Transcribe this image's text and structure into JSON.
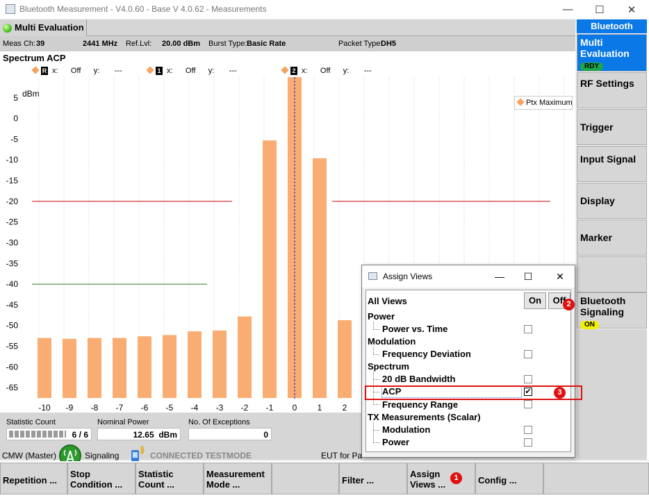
{
  "window": {
    "title": "Bluetooth Measurement  - V4.0.60 - Base V 4.0.62 - Measurements",
    "minimize": "—",
    "maximize": "☐",
    "close": "✕"
  },
  "tab": {
    "label": "Multi Evaluation"
  },
  "info": {
    "meas_ch_label": "Meas Ch:",
    "meas_ch_value": "39",
    "freq_value": "2441 MHz",
    "ref_lvl_label": "Ref.Lvl:",
    "ref_lvl_value": "20.00 dBm",
    "burst_type_label": "Burst Type:",
    "burst_type_value": "Basic Rate",
    "packet_type_label": "Packet Type:",
    "packet_type_value": "DH5"
  },
  "plot": {
    "title": "Spectrum ACP",
    "markers": [
      {
        "badge": "R",
        "x_label": "x:",
        "x_value": "Off",
        "y_label": "y:",
        "y_value": "---"
      },
      {
        "badge": "1",
        "x_label": "x:",
        "x_value": "Off",
        "y_label": "y:",
        "y_value": "---"
      },
      {
        "badge": "2",
        "x_label": "x:",
        "x_value": "Off",
        "y_label": "y:",
        "y_value": "---"
      }
    ],
    "legend": "Ptx Maximum"
  },
  "chart_data": {
    "type": "bar",
    "ylabel": "dBm",
    "categories": [
      "-10",
      "-9",
      "-8",
      "-7",
      "-6",
      "-5",
      "-4",
      "-3",
      "-2",
      "-1",
      "0",
      "1",
      "2"
    ],
    "series": [
      {
        "name": "Ptx Maximum",
        "values": [
          -53,
          -53.2,
          -53,
          -53,
          -52.6,
          -52.3,
          -51.4,
          -51.2,
          -47.8,
          -5.3,
          10,
          -9.6,
          -48.7
        ]
      }
    ],
    "ylim": [
      -68,
      10
    ],
    "yticks": [
      5,
      0,
      -5,
      -10,
      -15,
      -20,
      -25,
      -30,
      -35,
      -40,
      -45,
      -50,
      -55,
      -60,
      -65
    ],
    "limit_lines": [
      {
        "y": -20,
        "from": "-10.5",
        "to": "-2.5",
        "color": "#cc0000"
      },
      {
        "y": -20,
        "from": "1.5",
        "to": "12",
        "color": "#cc0000"
      },
      {
        "y": -40,
        "from": "-10.5",
        "to": "-3.5",
        "color": "#2f7a1a"
      }
    ],
    "grid": "vertical",
    "bar_color": "#f9ad72"
  },
  "stats": {
    "statistic_count_label": "Statistic Count",
    "statistic_count_value": "6 / 6",
    "nominal_power_label": "Nominal Power",
    "nominal_power_value": "12.65  dBm",
    "exceptions_label": "No. Of Exceptions",
    "exceptions_value": "0"
  },
  "status": {
    "cmw": "CMW (Master)",
    "signaling": "Signaling",
    "connected": "CONNECTED TESTMODE",
    "eut": "EUT for Pa"
  },
  "right_keys": {
    "header": "Bluetooth",
    "multi_eval": "Multi Evaluation",
    "rdy": "RDY",
    "rf_settings": "RF Settings",
    "trigger": "Trigger",
    "input_signal": "Input Signal",
    "display": "Display",
    "marker": "Marker",
    "bt_signaling": "Bluetooth Signaling",
    "on": "ON"
  },
  "bottom_keys": {
    "repetition": "Repetition ...",
    "stop_condition": "Stop Condition ...",
    "statistic_count": "Statistic Count ...",
    "measurement_mode": "Measurement Mode ...",
    "filter": "Filter ...",
    "assign_views": "Assign Views ...",
    "config": "Config ..."
  },
  "dialog": {
    "title": "Assign Views",
    "all_views": "All Views",
    "on_btn": "On",
    "off_btn": "Off",
    "items": {
      "power": "Power",
      "power_vs_time": "Power vs. Time",
      "modulation": "Modulation",
      "frequency_deviation": "Frequency Deviation",
      "spectrum": "Spectrum",
      "bandwidth_20db": "20 dB Bandwidth",
      "acp": "ACP",
      "frequency_range": "Frequency Range",
      "tx_scalar": "TX Measurements (Scalar)",
      "tx_modulation": "Modulation",
      "tx_power": "Power"
    },
    "checked_mark": "✔"
  },
  "annotations": {
    "one": "1",
    "two": "2",
    "three": "3"
  }
}
